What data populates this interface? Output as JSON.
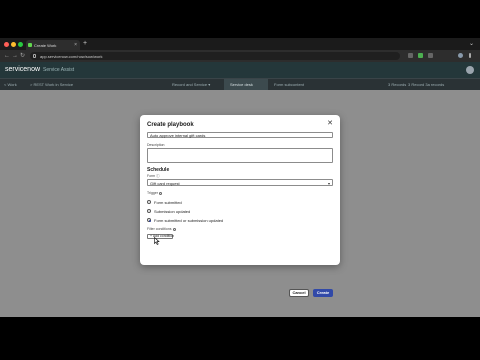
{
  "browser": {
    "tab_title": "Create Work",
    "url": "app.servicenow.com/now/sow/work",
    "colors": {
      "close": "#ff5f57",
      "minimize": "#febc2e",
      "maximize": "#28c840"
    }
  },
  "app": {
    "logo": "servicenow",
    "subtitle": "Service Assist",
    "nav": {
      "home": "< Work",
      "breadcrumb": "> REST Work in Service",
      "tab_left": "Record and Service ▾",
      "tab_active": "Service desk",
      "tab_right": "Form subcontent",
      "right_1": "3 Records",
      "right_2": "3 Record 3a records"
    }
  },
  "modal": {
    "title": "Create playbook",
    "name_value": "Auto approve internal gift cards",
    "description_label": "Description",
    "description_value": "",
    "schedule_heading": "Schedule",
    "form_label": "Form ⓘ",
    "form_value": "Gift card request",
    "trigger_label": "Trigger",
    "trigger_options": [
      {
        "label": "Form submitted",
        "selected": false
      },
      {
        "label": "Submission updated",
        "selected": false
      },
      {
        "label": "Form submitted or submission updated",
        "selected": true
      }
    ],
    "filter_label": "Filter conditions",
    "add_condition": "+ Add condition",
    "cancel_label": "Cancel",
    "create_label": "Create"
  }
}
